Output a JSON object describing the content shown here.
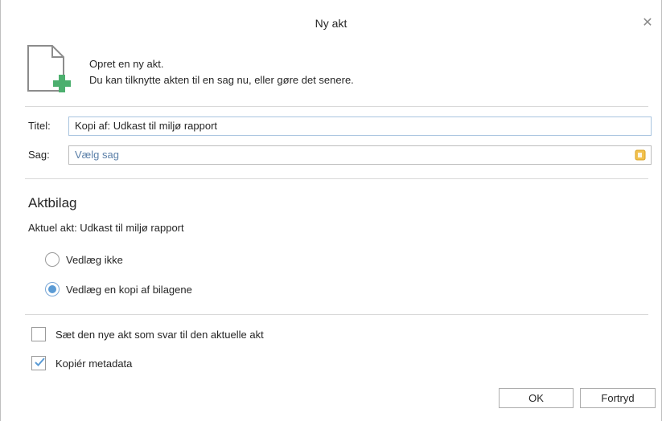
{
  "dialog": {
    "title": "Ny akt",
    "close_icon": "close-icon",
    "header_icon": "new-document-plus-icon"
  },
  "intro": {
    "line1": "Opret en ny akt.",
    "line2": "Du kan tilknytte akten til en sag nu, eller gøre det senere."
  },
  "fields": {
    "title_label": "Titel:",
    "title_value": "Kopi af: Udkast til miljø rapport",
    "case_label": "Sag:",
    "case_placeholder": "Vælg sag",
    "case_picker_icon": "case-picker-icon"
  },
  "attachments": {
    "heading": "Aktbilag",
    "current": "Aktuel akt: Udkast til miljø rapport",
    "options": [
      {
        "label": "Vedlæg ikke",
        "selected": false
      },
      {
        "label": "Vedlæg en kopi af bilagene",
        "selected": true
      }
    ]
  },
  "checkboxes": [
    {
      "label": "Sæt den nye akt som svar til den aktuelle akt",
      "checked": false
    },
    {
      "label": "Kopiér metadata",
      "checked": true
    }
  ],
  "buttons": {
    "ok": "OK",
    "cancel": "Fortryd"
  },
  "colors": {
    "accent": "#5b9bd5",
    "icon_green": "#4caf6e",
    "case_icon_yellow": "#f2c14e"
  }
}
